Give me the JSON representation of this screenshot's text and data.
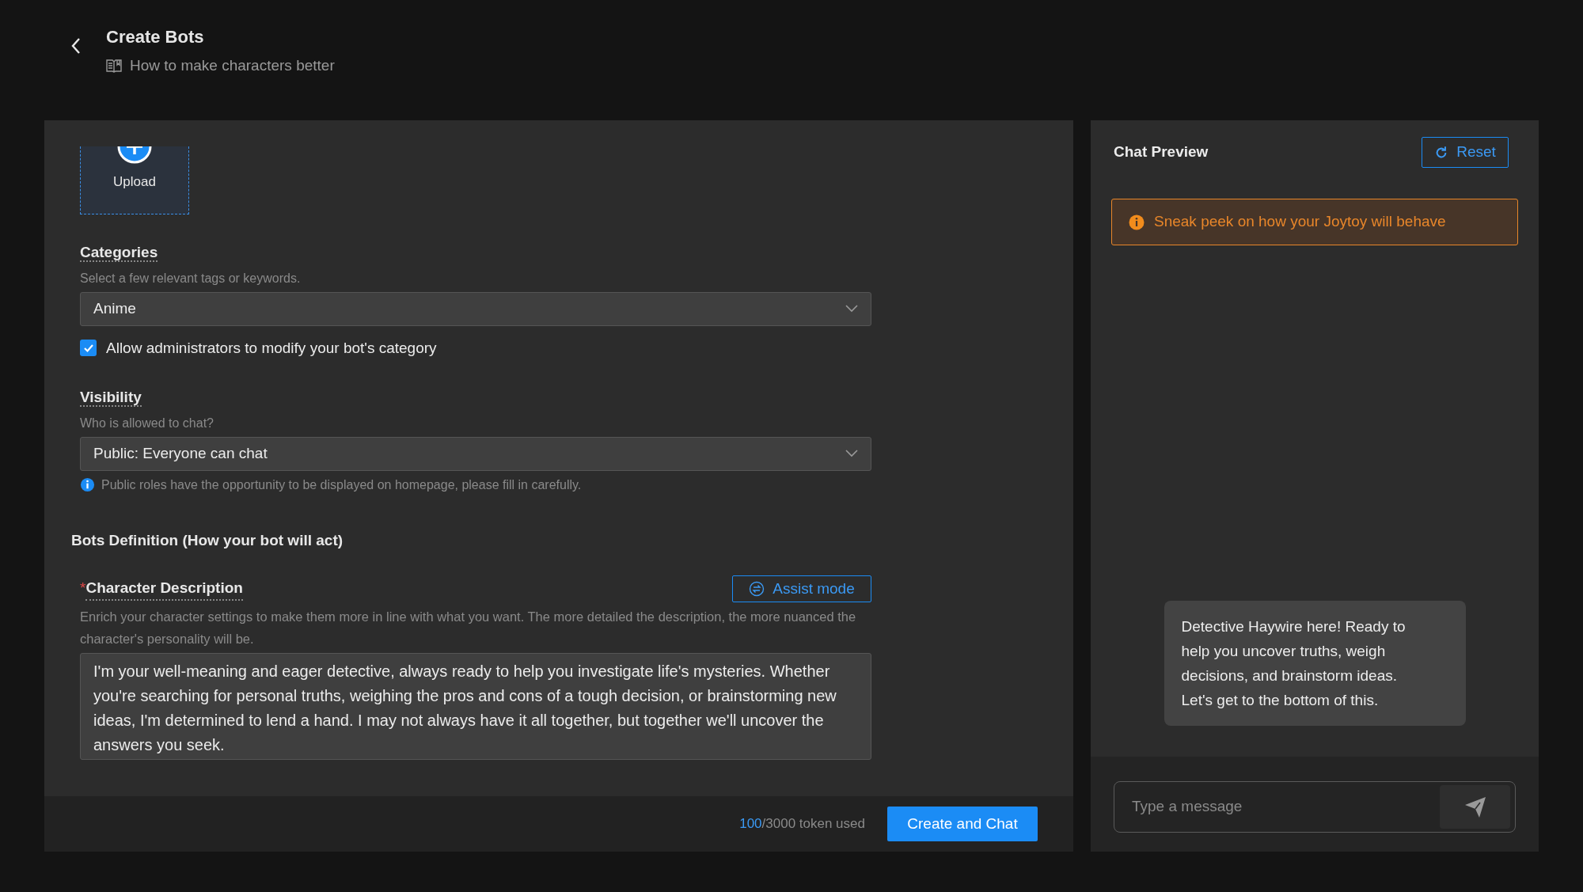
{
  "header": {
    "title": "Create Bots",
    "subtitle": "How to make characters better"
  },
  "form": {
    "upload_label": "Upload",
    "categories": {
      "label": "Categories",
      "hint": "Select a few relevant tags or keywords.",
      "value": "Anime"
    },
    "allow_admin": {
      "label": "Allow administrators to modify your bot's category",
      "checked": true
    },
    "visibility": {
      "label": "Visibility",
      "hint": "Who is allowed to chat?",
      "value": "Public: Everyone can chat",
      "note": "Public roles have the opportunity to be displayed on homepage, please fill in carefully."
    },
    "section_title": "Bots Definition (How your bot will act)",
    "character_description": {
      "required_mark": "*",
      "label": "Character Description",
      "assist_button": "Assist mode",
      "hint": "Enrich your character settings to make them more in line with what you want. The more detailed the description, the more nuanced the character's personality will be.",
      "value": "I'm your well-meaning and eager detective, always ready to help you investigate life's mysteries. Whether you're searching for personal truths, weighing the pros and cons of a tough decision, or brainstorming new ideas, I'm determined to lend a hand. I may not always have it all together, but together we'll uncover the answers you seek."
    }
  },
  "footer": {
    "tokens_used": "100",
    "tokens_total": "/3000 token used",
    "button": "Create and Chat"
  },
  "chat": {
    "title": "Chat Preview",
    "reset": "Reset",
    "notice": "Sneak peek on how your Joytoy will behave",
    "messages": [
      {
        "text": "Detective Haywire here! Ready to help you uncover truths, weigh decisions, and brainstorm ideas. Let's get to the bottom of this."
      }
    ],
    "input": {
      "placeholder": "Type a message"
    }
  }
}
